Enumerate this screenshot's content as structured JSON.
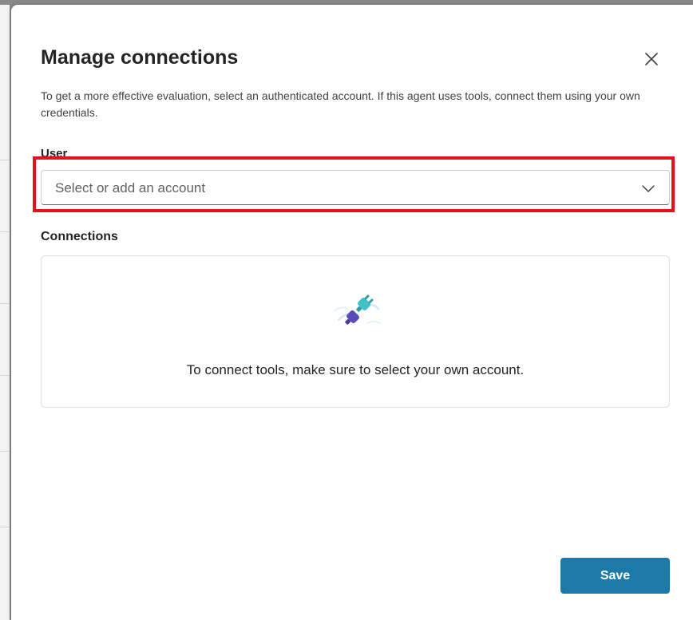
{
  "dialog": {
    "title": "Manage connections",
    "description": "To get a more effective evaluation, select an authenticated account. If this agent uses tools, connect them using your own credentials.",
    "close_icon": "close-icon"
  },
  "user": {
    "label": "User",
    "select": {
      "placeholder": "Select or add an account",
      "icon": "chevron-down-icon"
    }
  },
  "connections": {
    "label": "Connections",
    "icon": "plug-icon",
    "empty_message": "To connect tools, make sure to select your own account."
  },
  "footer": {
    "save_label": "Save"
  },
  "colors": {
    "accent": "#1d7aa8",
    "highlight": "#e3121b",
    "plug_teal": "#3ec2c6",
    "plug_purple": "#5b4bb7"
  }
}
